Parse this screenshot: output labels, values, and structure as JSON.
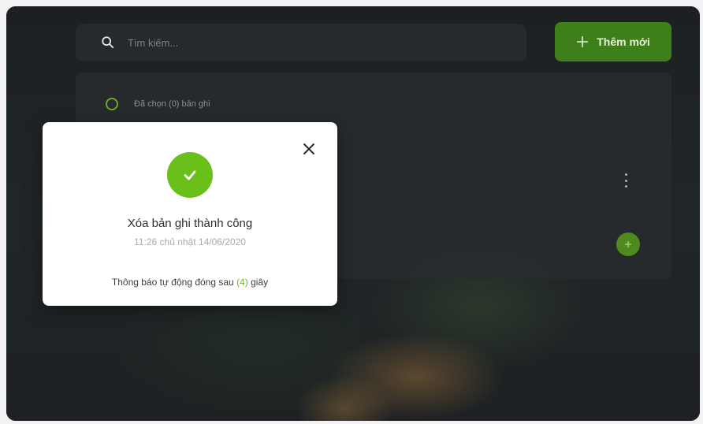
{
  "search": {
    "placeholder": "Tìm kiếm..."
  },
  "toolbar": {
    "add_label": "Thêm mới"
  },
  "list": {
    "selection_text": "Đã chọn (0) bản ghi"
  },
  "modal": {
    "title": "Xóa bản ghi thành công",
    "timestamp": "11:26 chủ nhật 14/06/2020",
    "footer_prefix": "Thông báo tự động đóng sau",
    "countdown": "(4)",
    "footer_suffix": "giây"
  },
  "colors": {
    "accent": "#6bbf1b",
    "button_green": "#3f7f1a",
    "background_dark": "#1a1e20"
  },
  "icons": [
    "search-icon",
    "plus-icon",
    "close-icon",
    "check-icon",
    "more-vertical-icon",
    "fab-icon"
  ]
}
